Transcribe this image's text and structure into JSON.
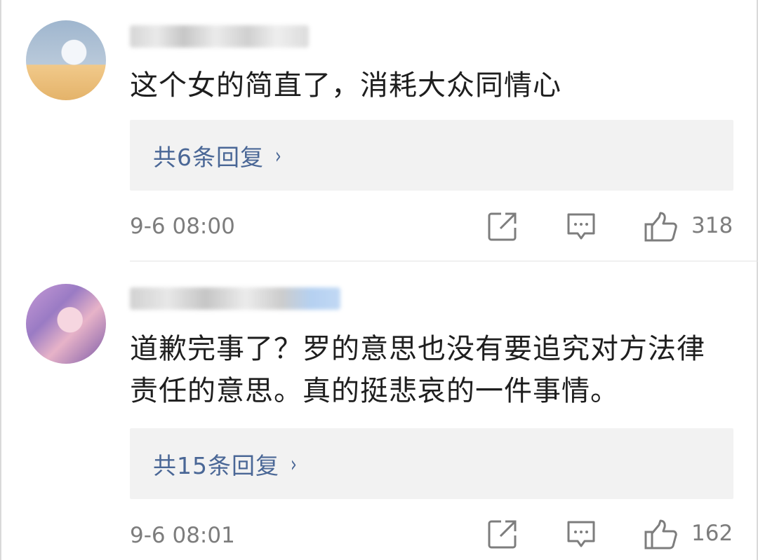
{
  "comments": [
    {
      "text": "这个女的简直了，消耗大众同情心",
      "replies_label": "共6条回复",
      "chevron": "›",
      "timestamp": "9-6 08:00",
      "like_count": "318",
      "icons": {
        "share": "share-icon",
        "comment": "comment-icon",
        "like": "thumbs-up-icon"
      }
    },
    {
      "text": "道歉完事了？罗的意思也没有要追究对方法律责任的意思。真的挺悲哀的一件事情。",
      "replies_label": "共15条回复",
      "chevron": "›",
      "timestamp": "9-6 08:01",
      "like_count": "162",
      "icons": {
        "share": "share-icon",
        "comment": "comment-icon",
        "like": "thumbs-up-icon"
      }
    }
  ],
  "colors": {
    "link": "#4a6796",
    "meta": "#7d7d7d",
    "reply_bg": "#f2f2f2"
  }
}
